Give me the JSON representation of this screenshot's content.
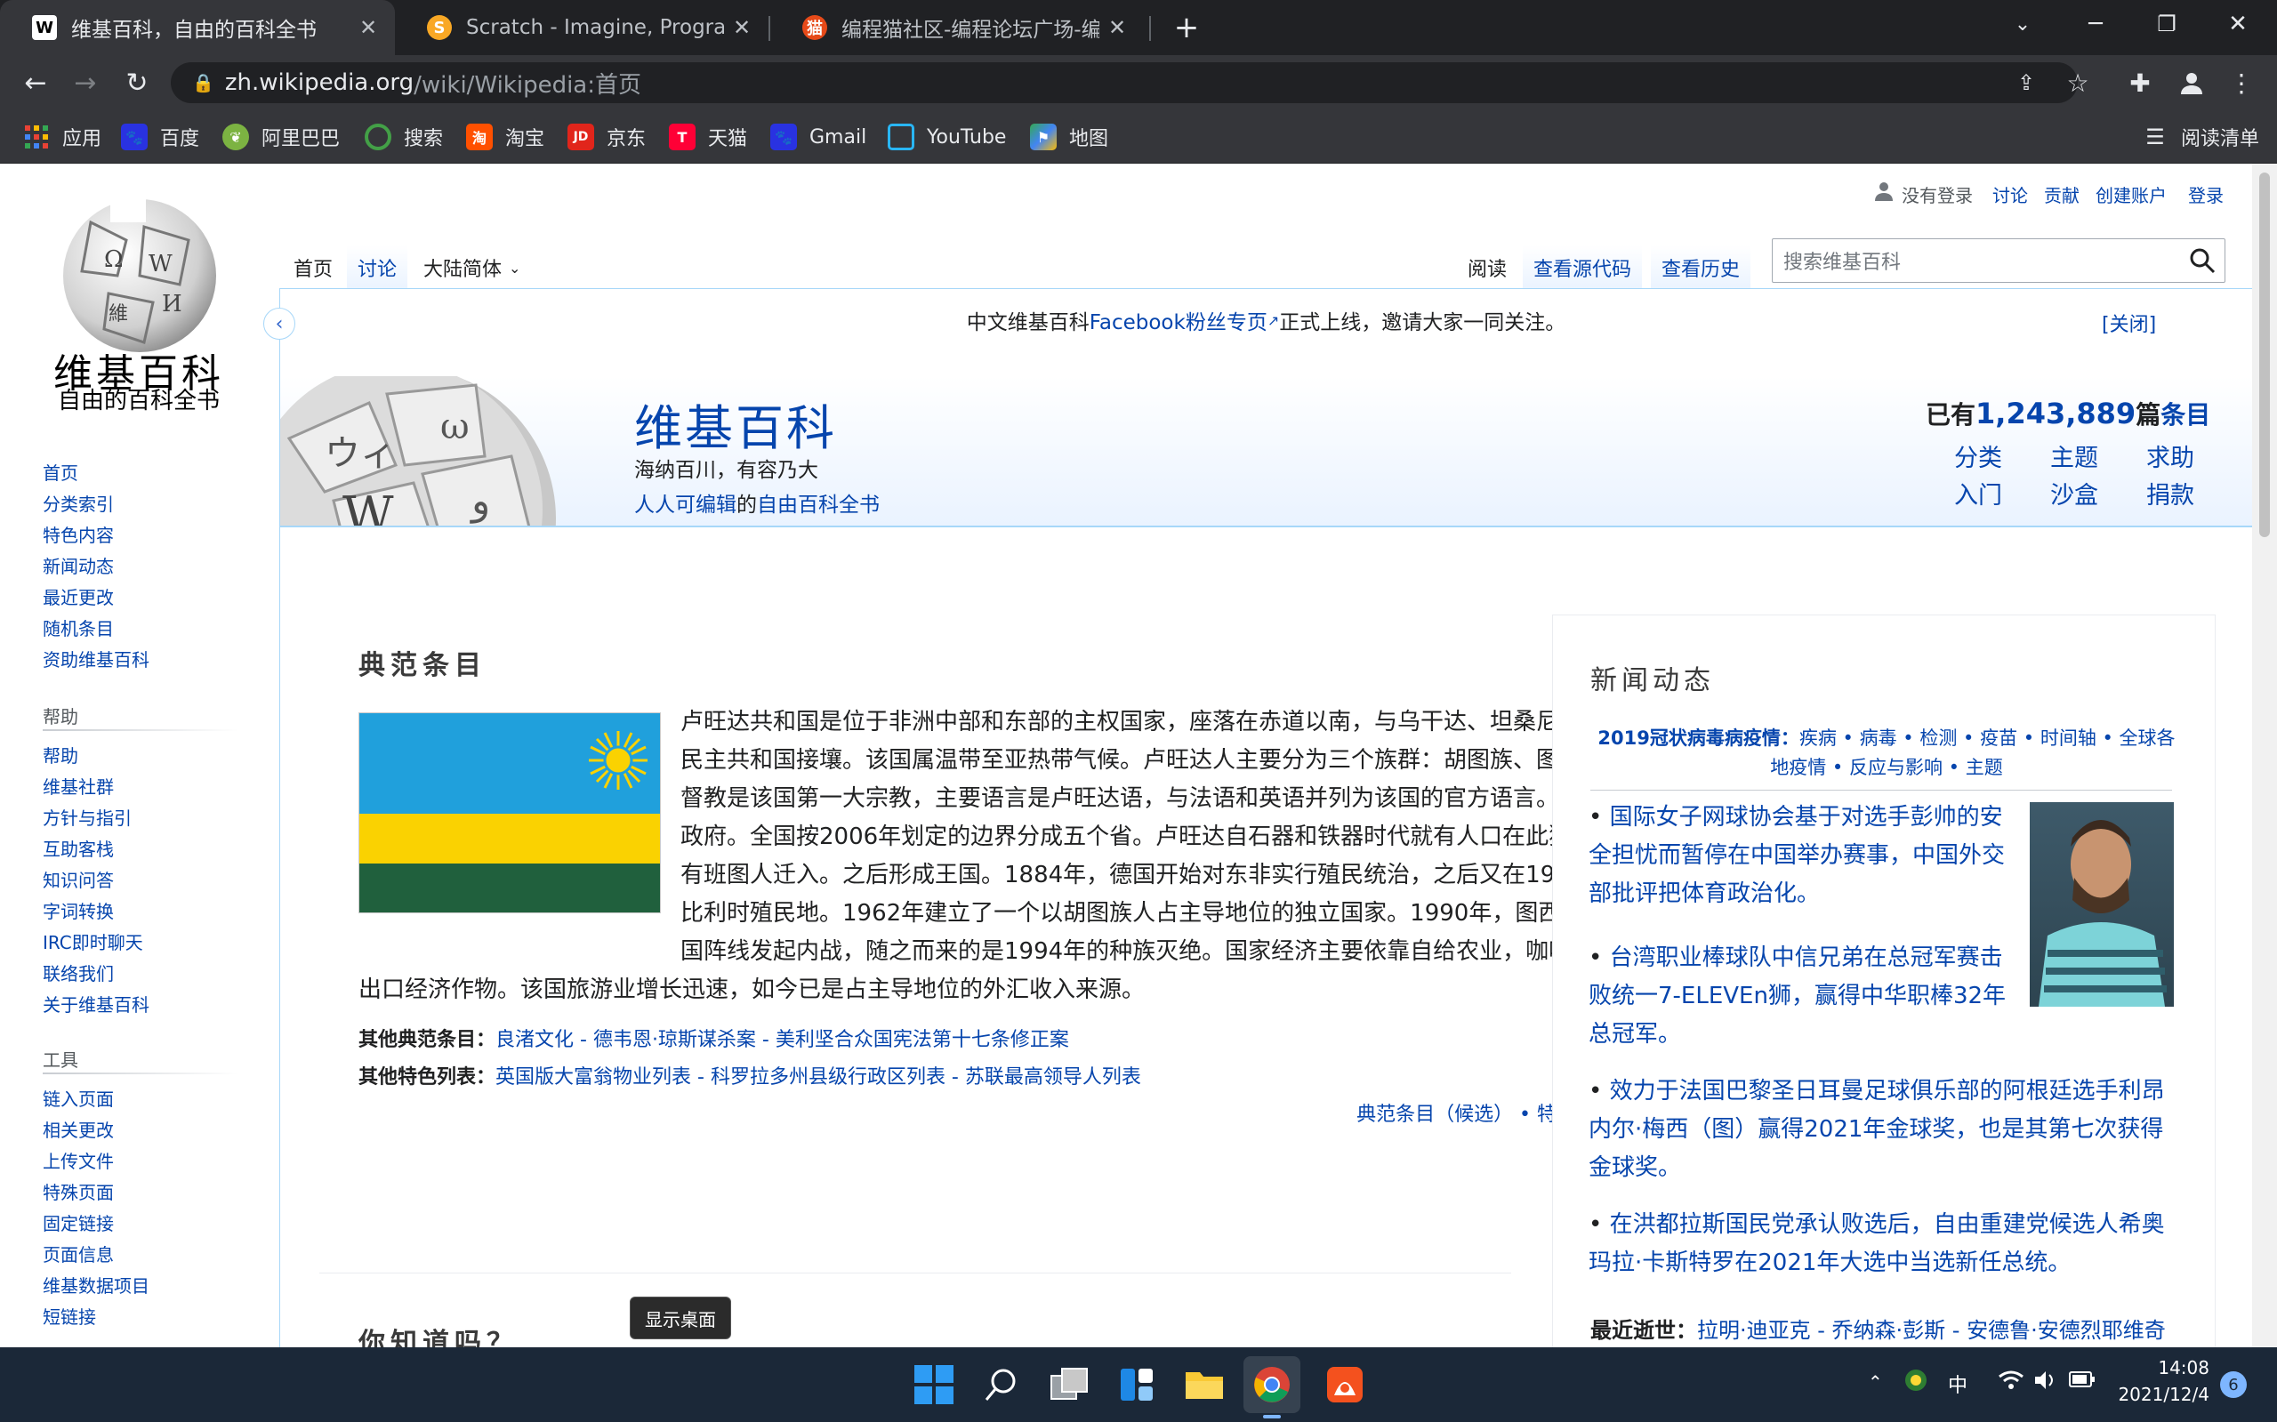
{
  "browser": {
    "tabs": [
      {
        "title": "维基百科，自由的百科全书",
        "active": true
      },
      {
        "title": "Scratch - Imagine, Program, Sh",
        "active": false
      },
      {
        "title": "编程猫社区-编程论坛广场-编程学",
        "active": false
      }
    ],
    "new_tab_label": "+",
    "url_host": "zh.wikipedia.org",
    "url_path": "/wiki/Wikipedia:首页",
    "bookmarks": [
      "应用",
      "百度",
      "阿里巴巴",
      "搜索",
      "淘宝",
      "京东",
      "天猫",
      "Gmail",
      "YouTube",
      "地图"
    ],
    "reading_list": "阅读清单"
  },
  "wiki": {
    "logo_title": "维基百科",
    "logo_subtitle": "自由的百科全书",
    "nav": [
      "首页",
      "分类索引",
      "特色内容",
      "新闻动态",
      "最近更改",
      "随机条目",
      "资助维基百科"
    ],
    "help_heading": "帮助",
    "help": [
      "帮助",
      "维基社群",
      "方针与指引",
      "互助客栈",
      "知识问答",
      "字词转换",
      "IRC即时聊天",
      "联络我们",
      "关于维基百科"
    ],
    "tools_heading": "工具",
    "tools": [
      "链入页面",
      "相关更改",
      "上传文件",
      "特殊页面",
      "固定链接",
      "页面信息",
      "维基数据项目",
      "短链接"
    ],
    "personal": [
      "没有登录",
      "讨论",
      "贡献",
      "创建账户",
      "登录"
    ],
    "left_tabs": [
      "首页",
      "讨论",
      "大陆简体"
    ],
    "right_tabs": [
      "阅读",
      "查看源代码",
      "查看历史"
    ],
    "search_placeholder": "搜索维基百科",
    "banner": {
      "pre": "中文维基百科",
      "link": "Facebook粉丝专页",
      "post": "正式上线，邀请大家一同关注。",
      "close": "[关闭]"
    },
    "welcome": {
      "title": "维基百科",
      "line1": "海纳百川，有容乃大",
      "line2_link1": "人人可编辑",
      "line2_mid": "的",
      "line2_link2": "自由百科全书",
      "count_pre": "已有",
      "count": "1,243,889",
      "count_post": "篇",
      "count_link": "条目",
      "portals": [
        "分类",
        "主题",
        "求助",
        "入门",
        "沙盒",
        "捐款"
      ]
    },
    "featured": {
      "heading": "典范条目",
      "para": "卢旺达共和国是位于非洲中部和东部的主权国家，座落在赤道以南，与乌干达、坦桑尼亚、布隆迪和刚果民主共和国接壤。该国属温带至亚热带气候。卢旺达人主要分为三个族群：胡图族、图西族和特瓦族。基督教是该国第一大宗教，主要语言是卢旺达语，与法语和英语并列为该国的官方语言。卢旺达实行总统制政府。全国按2006年划定的边界分成五个省。卢旺达自石器和铁器时代就有人口在此狩猎采集，之后又有班图人迁入。之后形成王国。1884年，德国开始对东非实行殖民统治，之后又在1916年一战期间成为比利时殖民地。1962年建立了一个以胡图族人占主导地位的独立国家。1990年，图西族领导的卢旺达爱国阵线发起内战，随之而来的是1994年的种族灭绝。国家经济主要依靠自给农业，咖啡和茶叶是主要的出口经济作物。该国旅游业增长迅速，如今已是占主导地位的外汇收入来源。",
      "other_label": "其他典范条目：",
      "other": "良渚文化 - 德韦恩·琼斯谋杀案 - 美利坚合众国宪法第十七条修正案",
      "lists_label": "其他特色列表：",
      "lists": "英国版大富翁物业列表 - 科罗拉多州县级行政区列表 - 苏联最高领导人列表",
      "footer": "典范条目（候选） • 特色列表（候选） • 存档"
    },
    "dyk_heading": "你知道吗？",
    "tooltip": "显示桌面",
    "news": {
      "heading": "新闻动态",
      "covid_label": "2019冠状病毒病疫情：",
      "covid_links": "疾病 • 病毒 • 检测 • 疫苗 • 时间轴 • 全球各地疫情 • 反应与影响 • 主题",
      "items": [
        "国际女子网球协会基于对选手彭帅的安全担忧而暂停在中国举办赛事，中国外交部批评把体育政治化。",
        "台湾职业棒球队中信兄弟在总冠军赛击败统一7-ELEVEn狮，赢得中华职棒32年总冠军。",
        "效力于法国巴黎圣日耳曼足球俱乐部的阿根廷选手利昂内尔·梅西（图）赢得2021年金球奖，也是其第七次获得金球奖。",
        "在洪都拉斯国民党承认败选后，自由重建党候选人希奥玛拉·卡斯特罗在2021年大选中当选新任总统。"
      ],
      "recent_label": "最近逝世：",
      "recent": "拉明·迪亚克 - 乔纳森·彭斯 - 安德鲁·安德烈耶维奇"
    }
  },
  "taskbar": {
    "ime": "中",
    "time": "14:08",
    "date": "2021/12/4",
    "badge": "6"
  },
  "colors": {
    "link": "#0645ad",
    "chrome_dark": "#202124",
    "chrome_tab": "#35363a",
    "taskbar": "#1b2838"
  }
}
